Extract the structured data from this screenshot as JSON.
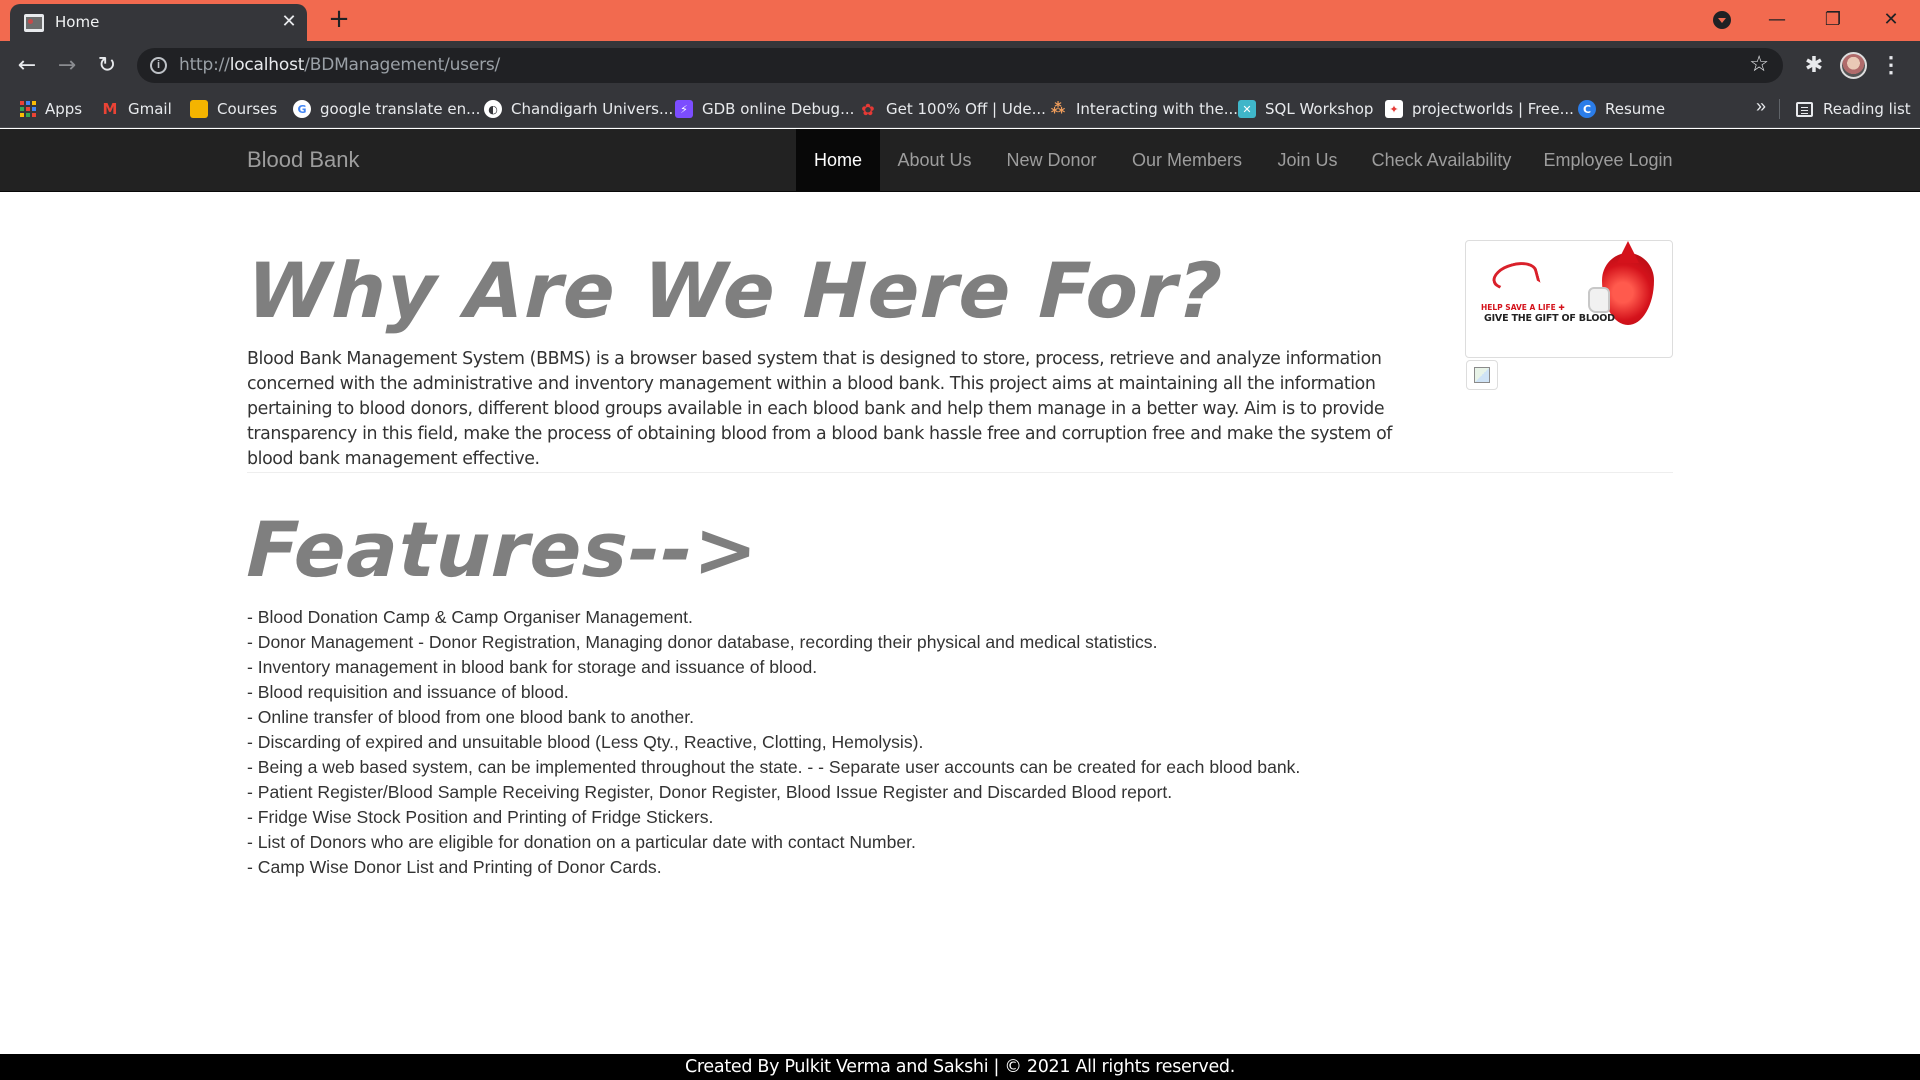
{
  "browser": {
    "tab": {
      "title": "Home",
      "close": "✕"
    },
    "new_tab": "+",
    "window_controls": {
      "minimize": "—",
      "restore": "❐",
      "close": "✕"
    },
    "nav": {
      "back": "←",
      "forward": "→",
      "reload": "↻"
    },
    "address": {
      "scheme": "http://",
      "host": "localhost",
      "path": "/BDManagement/users/"
    },
    "bookmarks": [
      {
        "label": "Apps",
        "icon": "apps-grid-icon"
      },
      {
        "label": "Gmail",
        "icon": "gmail-icon",
        "color": "#ea4335"
      },
      {
        "label": "Courses",
        "icon": "courses-icon",
        "color": "#f4b400"
      },
      {
        "label": "google translate en...",
        "icon": "google-icon",
        "color": "#ffffff"
      },
      {
        "label": "Chandigarh Univers...",
        "icon": "globe-icon",
        "color": "#ffffff"
      },
      {
        "label": "GDB online Debug...",
        "icon": "gdb-icon",
        "color": "#7c4dff"
      },
      {
        "label": "Get 100% Off | Ude...",
        "icon": "udemy-icon",
        "color": "#e53935"
      },
      {
        "label": "Interacting with the...",
        "icon": "handshake-icon",
        "color": "#f29f5c"
      },
      {
        "label": "SQL Workshop",
        "icon": "sql-icon",
        "color": "#3fb6c9"
      },
      {
        "label": "projectworlds | Free...",
        "icon": "projectworlds-icon",
        "color": "#ffffff"
      },
      {
        "label": "Resume",
        "icon": "resume-icon",
        "color": "#2b7de9"
      }
    ],
    "bookmarks_more": "»",
    "reading_list": "Reading list"
  },
  "site": {
    "brand": "Blood Bank",
    "nav": [
      "Home",
      "About Us",
      "New Donor",
      "Our Members",
      "Join Us",
      "Check Availability",
      "Employee Login"
    ],
    "active_nav": "Home",
    "hero_title": "Why Are We Here For?",
    "intro": "Blood Bank Management System (BBMS) is a browser based system that is designed to store, process, retrieve and analyze information concerned with the administrative and inventory management within a blood bank. This project aims at maintaining all the information pertaining to blood donors, different blood groups available in each blood bank and help them manage in a better way. Aim is to provide transparency in this field, make the process of obtaining blood from a blood bank hassle free and corruption free and make the system of blood bank management effective.",
    "image_caption": {
      "line1": "HELP SAVE A LIFE ✚",
      "line2": "GIVE THE GIFT OF BLOOD"
    },
    "features_title": "Features-->",
    "features": [
      "- Blood Donation Camp & Camp Organiser Management.",
      "- Donor Management - Donor Registration, Managing donor database, recording their physical and medical statistics.",
      "- Inventory management in blood bank for storage and issuance of blood.",
      "- Blood requisition and issuance of blood.",
      "- Online transfer of blood from one blood bank to another.",
      "- Discarding of expired and unsuitable blood (Less Qty., Reactive, Clotting, Hemolysis).",
      "- Being a web based system, can be implemented throughout the state. - - Separate user accounts can be created for each blood bank.",
      "- Patient Register/Blood Sample Receiving Register, Donor Register, Blood Issue Register and Discarded Blood report.",
      "- Fridge Wise Stock Position and Printing of Fridge Stickers.",
      "- List of Donors who are eligible for donation on a particular date with contact Number.",
      "- Camp Wise Donor List and Printing of Donor Cards."
    ],
    "footer": "Created By Pulkit Verma and Sakshi | © 2021 All rights reserved."
  },
  "colors": {
    "tabstrip": "#f26a4f",
    "toolbar": "#35363a",
    "navbar": "#222222",
    "nav_active": "#080808",
    "heading": "#7f7f7f",
    "footer": "#000000"
  }
}
